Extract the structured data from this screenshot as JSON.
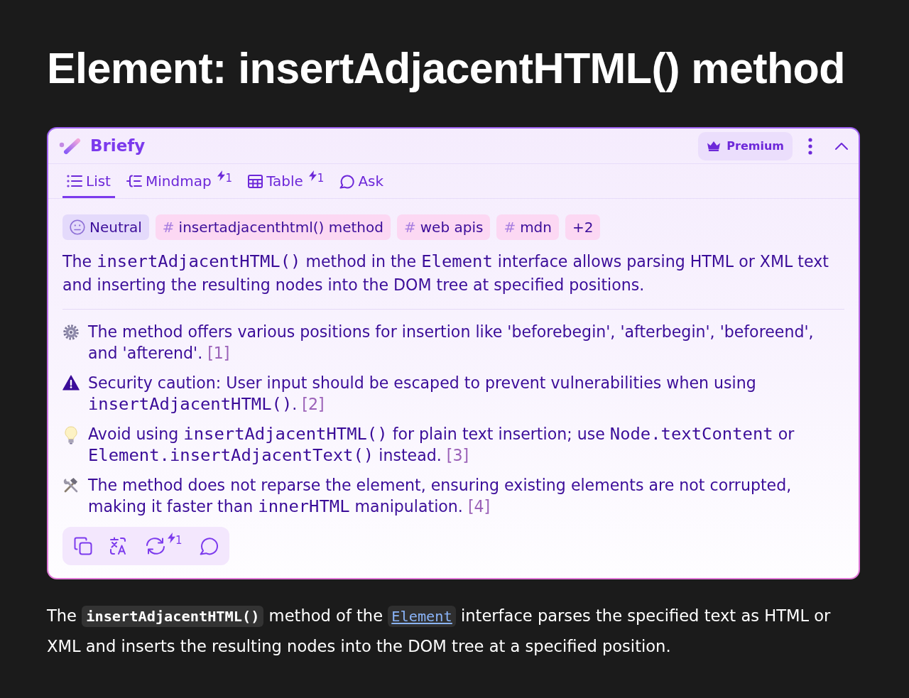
{
  "page": {
    "title": "Element: insertAdjacentHTML() method"
  },
  "widget": {
    "brand": "Briefy",
    "premium_label": "Premium",
    "expanded": true,
    "tabs": [
      {
        "kind": "list",
        "label": "List",
        "selected": true
      },
      {
        "kind": "mindmap",
        "label": "Mindmap",
        "selected": false,
        "cost": "1"
      },
      {
        "kind": "table",
        "label": "Table",
        "selected": false,
        "cost": "1"
      },
      {
        "kind": "ask",
        "label": "Ask",
        "selected": false
      }
    ],
    "tags": [
      {
        "kind": "sentiment",
        "label": "Neutral"
      },
      {
        "kind": "topic",
        "symbol": "#",
        "label": "insertadjacenthtml() method"
      },
      {
        "kind": "topic",
        "symbol": "#",
        "label": "web apis"
      },
      {
        "kind": "topic",
        "symbol": "#",
        "label": "mdn"
      },
      {
        "kind": "more",
        "label": "+2"
      }
    ],
    "summary": [
      {
        "kind": "text",
        "text": "The "
      },
      {
        "kind": "code",
        "text": "insertAdjacentHTML()"
      },
      {
        "kind": "text",
        "text": " method in the "
      },
      {
        "kind": "code",
        "text": "Element"
      },
      {
        "kind": "text",
        "text": " interface allows parsing HTML or XML text and inserting the resulting nodes into the DOM tree at specified positions."
      }
    ],
    "points": [
      {
        "kind": "feature",
        "segments": [
          {
            "kind": "text",
            "text": "The method offers various positions for insertion like 'beforebegin', 'afterbegin', 'beforeend', and 'afterend'. "
          },
          {
            "kind": "ref",
            "text": "[1]"
          }
        ]
      },
      {
        "kind": "warning",
        "segments": [
          {
            "kind": "text",
            "text": "Security caution: User input should be escaped to prevent vulnerabilities when using "
          },
          {
            "kind": "code",
            "text": "insertAdjacentHTML()"
          },
          {
            "kind": "text",
            "text": ". "
          },
          {
            "kind": "ref",
            "text": "[2]"
          }
        ]
      },
      {
        "kind": "tip",
        "segments": [
          {
            "kind": "text",
            "text": "Avoid using "
          },
          {
            "kind": "code",
            "text": "insertAdjacentHTML()"
          },
          {
            "kind": "text",
            "text": " for plain text insertion; use "
          },
          {
            "kind": "code",
            "text": "Node.textContent"
          },
          {
            "kind": "text",
            "text": " or "
          },
          {
            "kind": "code",
            "text": "Element.insertAdjacentText()"
          },
          {
            "kind": "text",
            "text": " instead. "
          },
          {
            "kind": "ref",
            "text": "[3]"
          }
        ]
      },
      {
        "kind": "tools",
        "segments": [
          {
            "kind": "text",
            "text": "The method does not reparse the element, ensuring existing elements are not corrupted, making it faster than "
          },
          {
            "kind": "code",
            "text": "innerHTML"
          },
          {
            "kind": "text",
            "text": " manipulation. "
          },
          {
            "kind": "ref",
            "text": "[4]"
          }
        ]
      }
    ],
    "actions": [
      {
        "kind": "copy"
      },
      {
        "kind": "translate"
      },
      {
        "kind": "regenerate",
        "cost": "1"
      },
      {
        "kind": "ask"
      }
    ]
  },
  "intro": [
    {
      "kind": "text",
      "text": "The "
    },
    {
      "kind": "code",
      "text": "insertAdjacentHTML()"
    },
    {
      "kind": "text",
      "text": " method of the "
    },
    {
      "kind": "link",
      "text": "Element"
    },
    {
      "kind": "text",
      "text": " interface parses the specified text as HTML or XML and inserts the resulting nodes into the DOM tree at a specified position."
    }
  ]
}
